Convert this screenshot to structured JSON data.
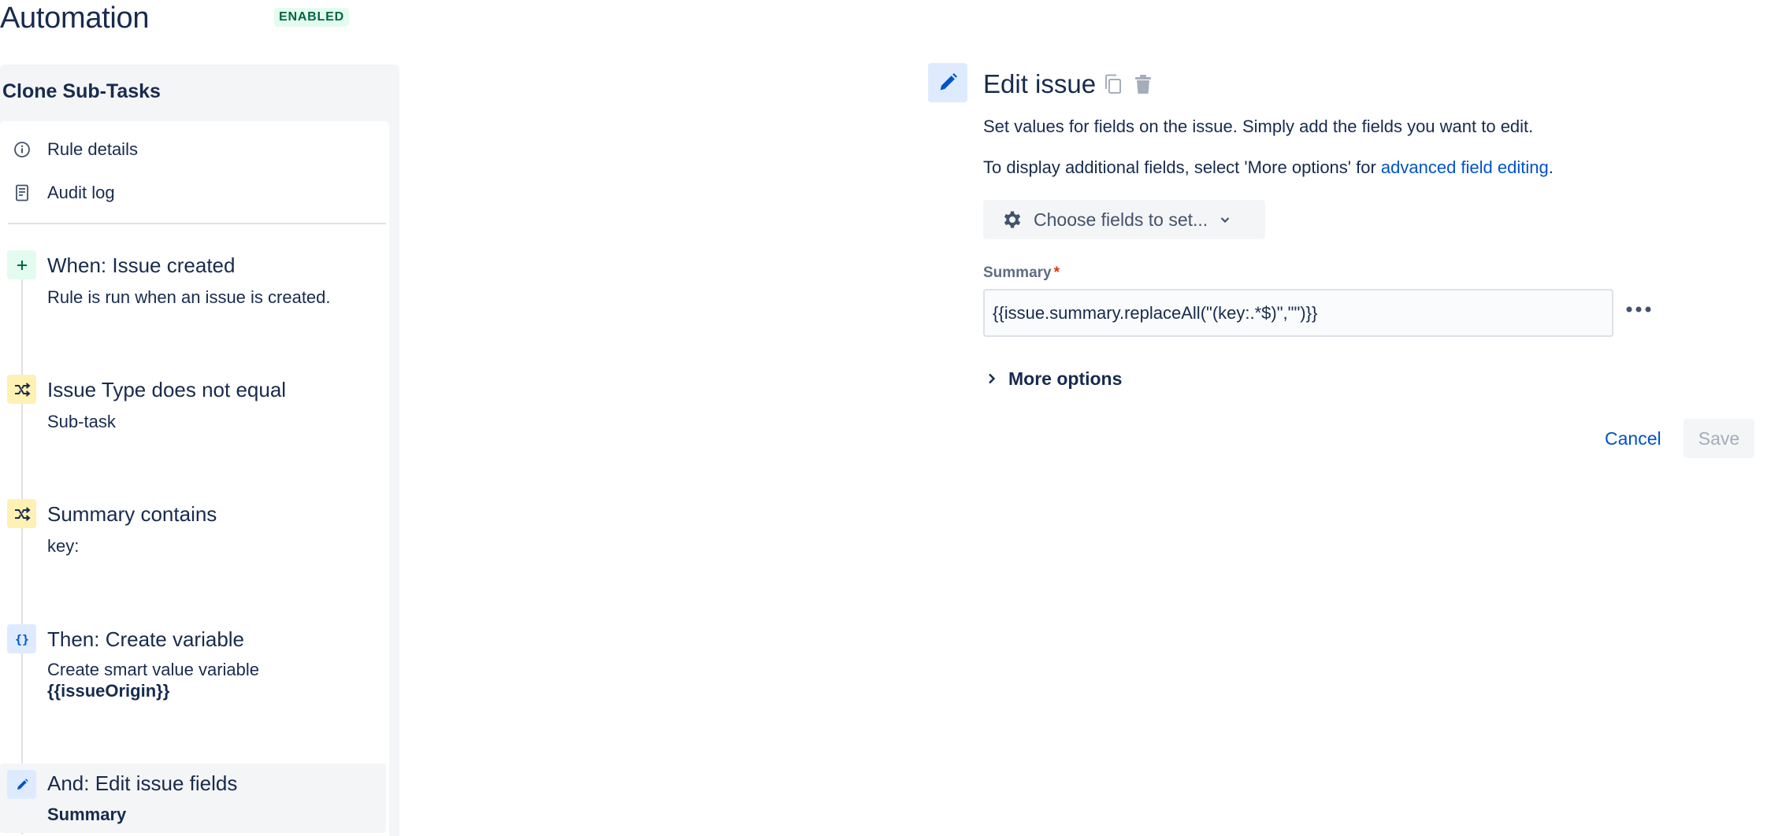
{
  "app": {
    "title": "Automation",
    "status": "ENABLED"
  },
  "sidebar": {
    "rule_name": "Clone Sub-Tasks",
    "nav": [
      {
        "label": "Rule details",
        "icon": "info-icon"
      },
      {
        "label": "Audit log",
        "icon": "document-icon"
      }
    ],
    "steps": [
      {
        "title": "When: Issue created",
        "description": "Rule is run when an issue is created.",
        "icon": "plus-icon",
        "kind": "trigger"
      },
      {
        "title": "Issue Type does not equal",
        "description": "Sub-task",
        "icon": "shuffle-icon",
        "kind": "condition"
      },
      {
        "title": "Summary contains",
        "description": "key:",
        "icon": "shuffle-icon",
        "kind": "condition"
      },
      {
        "title": "Then: Create variable",
        "description": "Create smart value variable",
        "description_bold": "{{issueOrigin}}",
        "icon": "braces-icon",
        "kind": "action"
      },
      {
        "title": "And: Edit issue fields",
        "description_bold": "Summary",
        "icon": "pencil-icon",
        "kind": "action",
        "selected": true
      }
    ]
  },
  "editor": {
    "title": "Edit issue",
    "icon": "pencil-icon",
    "description_1": "Set values for fields on the issue. Simply add the fields you want to edit.",
    "description_2_prefix": "To display additional fields, select 'More options' for ",
    "description_2_link": "advanced field editing",
    "description_2_suffix": ".",
    "choose_fields_label": "Choose fields to set...",
    "field": {
      "label": "Summary",
      "required_marker": "*",
      "value": "{{issue.summary.replaceAll(\"(key:.*$)\",\"\")}}"
    },
    "more_options_label": "More options",
    "cancel_label": "Cancel",
    "save_label": "Save"
  },
  "colors": {
    "link": "#0052cc",
    "text": "#172b4d",
    "status_bg": "#e3fcef",
    "status_text": "#006644",
    "trigger_bg": "#e3fcef",
    "condition_bg": "#fff0b3",
    "action_bg": "#deebff",
    "required": "#de350b"
  }
}
